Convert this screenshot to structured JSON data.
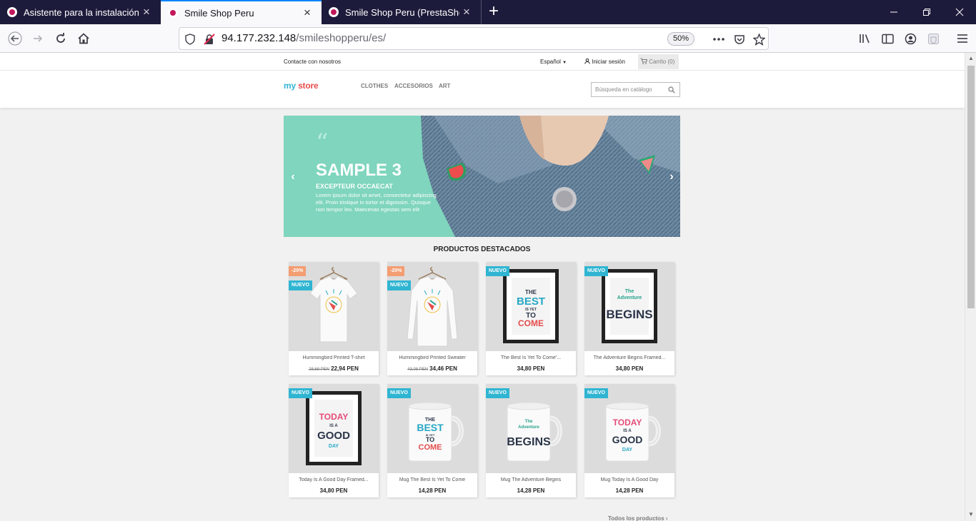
{
  "browser": {
    "tabs": [
      {
        "title": "Asistente para la instalación de"
      },
      {
        "title": "Smile Shop Peru"
      },
      {
        "title": "Smile Shop Peru (PrestaShop™)"
      }
    ],
    "url_host": "94.177.232.148",
    "url_path": "/smileshopperu/es/",
    "zoom": "50%"
  },
  "topnav": {
    "contact": "Contacte con nosotros",
    "language": "Español",
    "login": "Iniciar sesión",
    "cart": "Carrito (0)"
  },
  "header": {
    "logo": {
      "part1": "my ",
      "part2": "store"
    },
    "menu": [
      "CLOTHES",
      "ACCESORIOS",
      "ART"
    ],
    "search_placeholder": "Búsqueda en catálogo"
  },
  "slider": {
    "quote": "“",
    "title": "SAMPLE 3",
    "subtitle": "EXCEPTEUR OCCAECAT",
    "text": "Lorem ipsum dolor sit amet, consectetur adipiscing elit. Proin tristique in tortor et dignissim. Quisque non tempor leo. Maecenas egestas sem elit"
  },
  "featured": {
    "title": "PRODUCTOS DESTACADOS",
    "all_link": "Todos los productos ›",
    "products": [
      {
        "name": "Hummingbird Printed T-shirt",
        "old_price": "28,68 PEN",
        "price": "22,94 PEN",
        "discount": "-20%",
        "badge": "NUEVO",
        "kind": "tshirt"
      },
      {
        "name": "Hummingbird Printed Sweater",
        "old_price": "43,08 PEN",
        "price": "34,46 PEN",
        "discount": "-20%",
        "badge": "NUEVO",
        "kind": "sweater"
      },
      {
        "name": "The Best Is Yet To Come'...",
        "old_price": "",
        "price": "34,80 PEN",
        "discount": "",
        "badge": "NUEVO",
        "kind": "frame-best"
      },
      {
        "name": "The Adventure Begins Framed...",
        "old_price": "",
        "price": "34,80 PEN",
        "discount": "",
        "badge": "NUEVO",
        "kind": "frame-adventure"
      },
      {
        "name": "Today Is A Good Day Framed...",
        "old_price": "",
        "price": "34,80 PEN",
        "discount": "",
        "badge": "NUEVO",
        "kind": "frame-today"
      },
      {
        "name": "Mug The Best Is Yet To Come",
        "old_price": "",
        "price": "14,28 PEN",
        "discount": "",
        "badge": "NUEVO",
        "kind": "mug-best"
      },
      {
        "name": "Mug The Adventure Begins",
        "old_price": "",
        "price": "14,28 PEN",
        "discount": "",
        "badge": "NUEVO",
        "kind": "mug-adventure"
      },
      {
        "name": "Mug Today Is A Good Day",
        "old_price": "",
        "price": "14,28 PEN",
        "discount": "",
        "badge": "NUEVO",
        "kind": "mug-today"
      }
    ]
  },
  "art_text": {
    "best": [
      "THE",
      "BEST",
      "IS YET",
      "TO",
      "COME"
    ],
    "adventure": [
      "The",
      "Adventure",
      "BEGINS"
    ],
    "today": [
      "TODAY",
      "IS A",
      "GOOD",
      "DAY"
    ]
  },
  "colors": {
    "accent": "#2fb5d2",
    "discount": "#f39d72",
    "slider_bg": "#7fd5bd",
    "logo_blue": "#2fb5d2",
    "logo_red": "#e54c4c"
  }
}
